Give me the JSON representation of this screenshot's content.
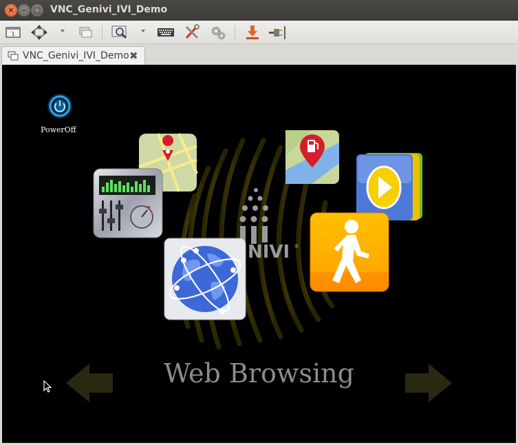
{
  "window": {
    "title": "VNC_Genivi_IVI_Demo",
    "controls": {
      "close": "×",
      "minimize": "–",
      "maximize": "□"
    }
  },
  "toolbar": {
    "buttons": [
      {
        "name": "toggle-fullscreen",
        "icon": "window-frame-icon"
      },
      {
        "name": "scale-view",
        "icon": "four-arrows-icon"
      },
      {
        "name": "switch-window",
        "icon": "windows-icon"
      },
      {
        "name": "zoom",
        "icon": "magnifier-icon"
      },
      {
        "name": "send-keys",
        "icon": "keyboard-icon"
      },
      {
        "name": "preferences",
        "icon": "tools-icon"
      },
      {
        "name": "settings",
        "icon": "gears-icon"
      },
      {
        "name": "save-screenshot",
        "icon": "download-icon"
      },
      {
        "name": "disconnect",
        "icon": "plug-icon"
      }
    ]
  },
  "tab": {
    "label": "VNC_Genivi_IVI_Demo",
    "close": "✖"
  },
  "screen": {
    "poweroff_label": "PowerOff",
    "logo_text": "NIVI",
    "logo_mark": "®",
    "caption": "Web Browsing",
    "apps": [
      "poweroff",
      "map-navigation",
      "equalizer",
      "fuel-station",
      "media-player",
      "web-browser",
      "pedestrian"
    ],
    "colors": {
      "background": "#000000",
      "caption": "#8d8c8a",
      "arrows": "#2a280e",
      "swirl": "#5a5108"
    }
  }
}
